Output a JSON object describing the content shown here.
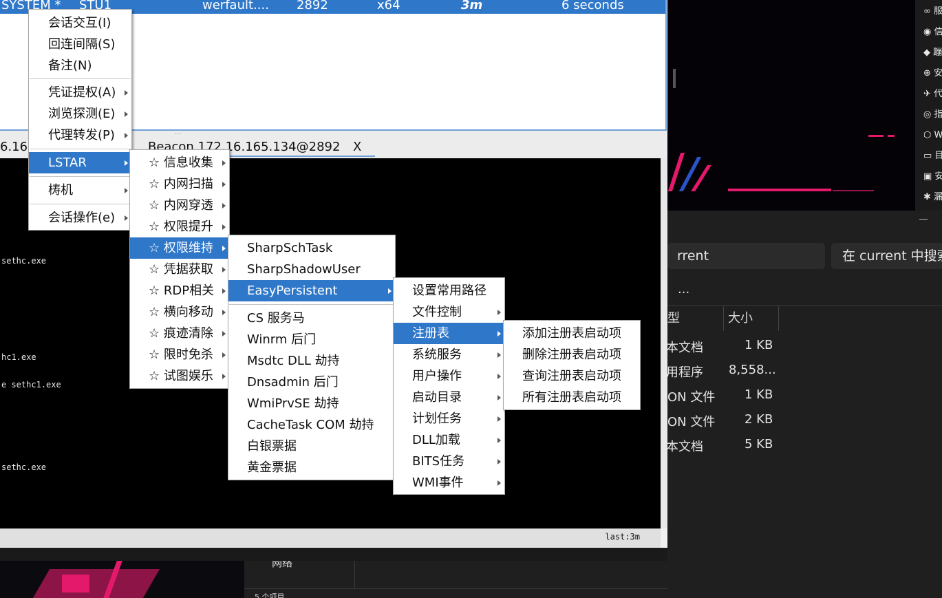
{
  "session_row": {
    "user": "SYSTEM *",
    "computer": "STU1",
    "process": "werfault....",
    "pid": "2892",
    "arch": "x64",
    "last": "3m",
    "sleep": "6 seconds"
  },
  "tabs": {
    "left_partial": "6.165",
    "beacon_tab": "Beacon 172.16.165.134@2892",
    "close": "X"
  },
  "console_lines": [
    "sethc.exe",
    "hc1.exe",
    "e sethc1.exe",
    "sethc.exe"
  ],
  "status": {
    "last": "last:3m"
  },
  "menu_main": [
    "会话交互(I)",
    "回连间隔(S)",
    "备注(N)",
    "凭证提权(A)",
    "浏览探测(E)",
    "代理转发(P)",
    "LSTAR",
    "梼机",
    "会话操作(e)"
  ],
  "menu_lstar": [
    "☆ 信息收集",
    "☆ 内网扫描",
    "☆ 内网穿透",
    "☆ 权限提升",
    "☆ 权限维持",
    "☆ 凭据获取",
    "☆ RDP相关",
    "☆ 横向移动",
    "☆ 痕迹清除",
    "☆ 限时免杀",
    "☆ 试图娱乐"
  ],
  "menu_persist": [
    "SharpSchTask",
    "SharpShadowUser",
    "EasyPersistent",
    "CS 服务马",
    "Winrm 后门",
    "Msdtc DLL 劫持",
    "Dnsadmin 后门",
    "WmiPrvSE 劫持",
    "CacheTask COM 劫持",
    "白银票据",
    "黄金票据"
  ],
  "menu_easy": [
    "设置常用路径",
    "文件控制",
    "注册表",
    "系统服务",
    "用户操作",
    "启动目录",
    "计划任务",
    "DLL加载",
    "BITS任务",
    "WMI事件"
  ],
  "menu_registry": [
    "添加注册表启动项",
    "删除注册表启动项",
    "查询注册表启动项",
    "所有注册表启动项"
  ],
  "explorer": {
    "path_partial": "rrent",
    "search_placeholder": "在 current 中搜索",
    "more": "...",
    "col_type_partial": "型",
    "col_size": "大小",
    "rows": [
      {
        "type": "本文档",
        "size": "1 KB"
      },
      {
        "type": "用程序",
        "size": "8,558..."
      },
      {
        "type": "ON 文件",
        "size": "1 KB"
      },
      {
        "type": "ON 文件",
        "size": "2 KB"
      },
      {
        "type": "本文档",
        "size": "5 KB"
      }
    ],
    "nav_partial": "网络",
    "item_count": "5 个项目"
  },
  "right_rail": [
    "服",
    "信",
    "蹦",
    "安",
    "代",
    "指",
    "W",
    "目",
    "安",
    "漏"
  ],
  "colors": {
    "selection": "#2f77c9",
    "neon": "#e5196b"
  }
}
